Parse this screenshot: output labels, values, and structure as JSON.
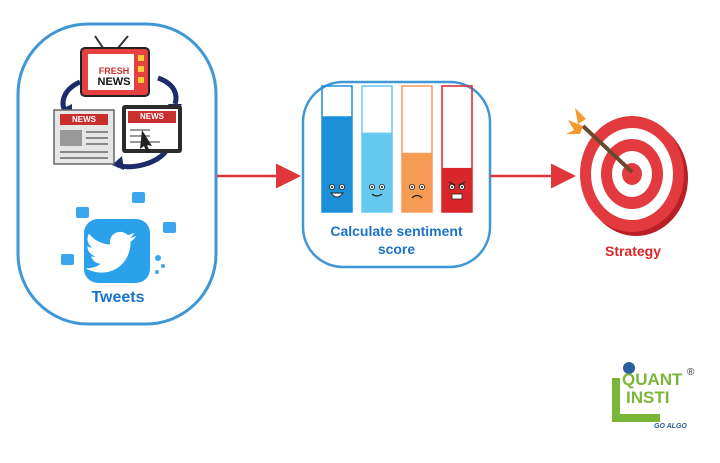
{
  "diagram": {
    "sources_label": "Tweets",
    "news_cards": {
      "fresh": "FRESH",
      "news": "NEWS",
      "news_small_1": "NEWS",
      "news_small_2": "NEWS"
    },
    "sentiment_label_line1": "Calculate sentiment",
    "sentiment_label_line2": "score",
    "strategy_label": "Strategy",
    "sentiment_bars": [
      {
        "fill_fraction": 0.76,
        "color": "#1b8fd8",
        "face": "happy"
      },
      {
        "fill_fraction": 0.63,
        "color": "#66c9f0",
        "face": "smile"
      },
      {
        "fill_fraction": 0.47,
        "color": "#f79a53",
        "face": "sad"
      },
      {
        "fill_fraction": 0.35,
        "color": "#d9262a",
        "face": "angry"
      }
    ],
    "colors": {
      "frame": "#3f97d6",
      "arrow": "#e0353a",
      "text_blue": "#1a73c9",
      "strategy_red": "#d9262a",
      "brand_green": "#7bb63a",
      "brand_blue": "#2a5f9e"
    }
  },
  "logo": {
    "line1": "QUANT",
    "line2": "INSTI",
    "tagline": "GO ALGO",
    "mark": "®"
  }
}
